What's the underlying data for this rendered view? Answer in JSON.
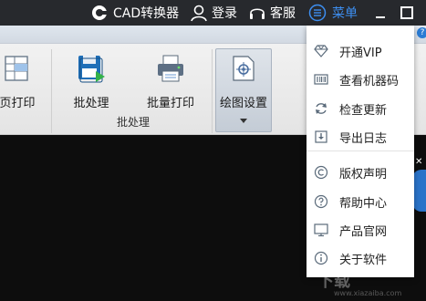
{
  "titlebar": {
    "app_label": "CAD转换器",
    "login_label": "登录",
    "service_label": "客服",
    "menu_label": "菜单",
    "menu_color": "#3d8ef0"
  },
  "ribbon": {
    "buttons": [
      {
        "label": "页打印"
      },
      {
        "label": "批处理"
      },
      {
        "label": "批量打印"
      },
      {
        "label": "绘图设置"
      }
    ],
    "group_label": "批处理"
  },
  "menu": {
    "items": [
      {
        "label": "开通VIP",
        "icon": "diamond-icon"
      },
      {
        "label": "查看机器码",
        "icon": "barcode-icon"
      },
      {
        "label": "检查更新",
        "icon": "refresh-icon"
      },
      {
        "label": "导出日志",
        "icon": "export-log-icon"
      },
      {
        "label": "版权声明",
        "icon": "copyright-icon"
      },
      {
        "label": "帮助中心",
        "icon": "help-icon"
      },
      {
        "label": "产品官网",
        "icon": "monitor-icon"
      },
      {
        "label": "关于软件",
        "icon": "info-icon"
      }
    ]
  },
  "watermark": {
    "text": "下载",
    "sub": "www.xiazaiba.com"
  },
  "help_badge": "?"
}
